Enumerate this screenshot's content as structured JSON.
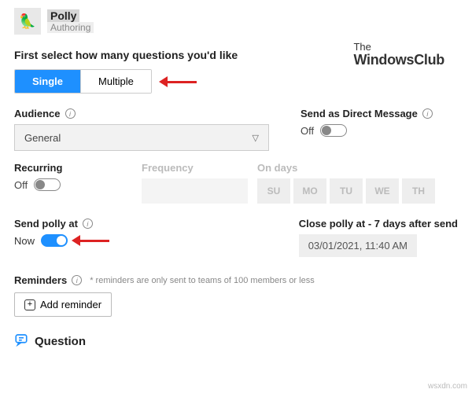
{
  "app": {
    "name": "Polly",
    "subtitle": "Authoring",
    "icon_glyph": "🦜"
  },
  "watermark": {
    "line1": "The",
    "line2": "WindowsClub"
  },
  "questions": {
    "prompt": "First select how many questions you'd like",
    "options": {
      "single": "Single",
      "multiple": "Multiple"
    },
    "selected": "single"
  },
  "audience": {
    "label": "Audience",
    "value": "General"
  },
  "direct_message": {
    "label": "Send as Direct Message",
    "state": "Off"
  },
  "recurring": {
    "label": "Recurring",
    "state": "Off"
  },
  "frequency": {
    "label": "Frequency"
  },
  "on_days": {
    "label": "On days",
    "days": [
      "SU",
      "MO",
      "TU",
      "WE",
      "TH"
    ]
  },
  "send_at": {
    "label": "Send polly at",
    "state": "Now"
  },
  "close_at": {
    "label": "Close polly at - 7 days after send",
    "value": "03/01/2021, 11:40 AM"
  },
  "reminders": {
    "label": "Reminders",
    "hint": "* reminders are only sent to teams of 100 members or less",
    "add_button": "Add reminder"
  },
  "question_section": {
    "title": "Question"
  },
  "credit": "wsxdn.com"
}
